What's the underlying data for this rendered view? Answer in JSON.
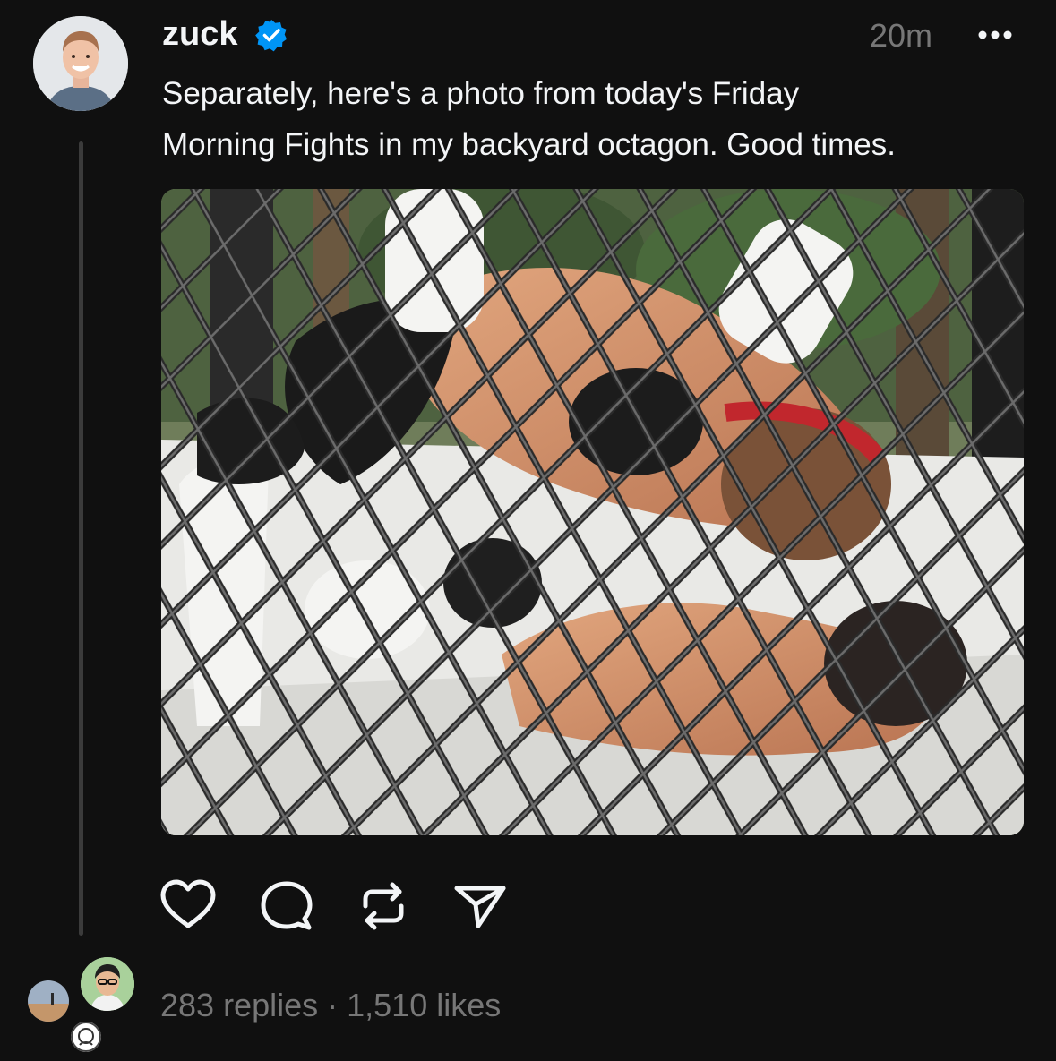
{
  "post": {
    "username": "zuck",
    "verified": true,
    "timestamp": "20m",
    "text": "Separately, here's a photo from today's Friday\nMorning Fights in my backyard octagon. Good times.",
    "image_alt": "Two men grappling on a white mat inside a chain-link cage outdoors"
  },
  "stats": {
    "replies": "283 replies",
    "separator": " · ",
    "likes": "1,510 likes"
  },
  "icons": {
    "more": "more-options-icon",
    "like": "heart-icon",
    "comment": "comment-bubble-icon",
    "repost": "repost-icon",
    "share": "send-icon",
    "verified": "verified-badge-icon"
  },
  "colors": {
    "background": "#101010",
    "text_primary": "#f3f5f7",
    "text_secondary": "#777777",
    "verified_blue": "#0095f6",
    "thread_line": "#3b3b3b"
  }
}
